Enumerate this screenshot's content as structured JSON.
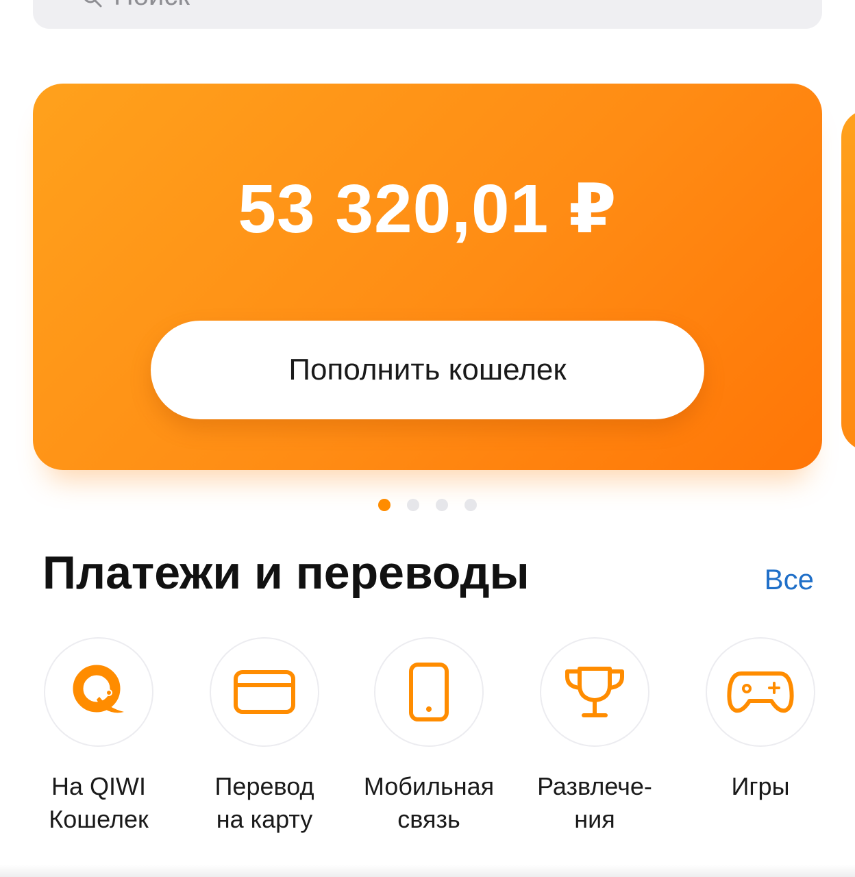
{
  "search": {
    "text": "Поиск"
  },
  "balance": {
    "amount": "53 320,01 ₽",
    "topup_label": "Пополнить кошелек"
  },
  "pager": {
    "count": 4,
    "active_index": 0
  },
  "payments": {
    "title": "Платежи и переводы",
    "all_label": "Все",
    "actions": [
      {
        "icon": "qiwi-logo-icon",
        "line1": "На QIWI",
        "line2": "Кошелек"
      },
      {
        "icon": "credit-card-icon",
        "line1": "Перевод",
        "line2": "на карту"
      },
      {
        "icon": "mobile-phone-icon",
        "line1": "Мобильная",
        "line2": "связь"
      },
      {
        "icon": "trophy-icon",
        "line1": "Развлече-",
        "line2": "ния"
      },
      {
        "icon": "gamepad-icon",
        "line1": "Игры",
        "line2": ""
      }
    ]
  },
  "colors": {
    "accent": "#ff8c00",
    "link": "#1f6fc8",
    "card_start": "#ffa11c",
    "card_end": "#ff7607"
  }
}
